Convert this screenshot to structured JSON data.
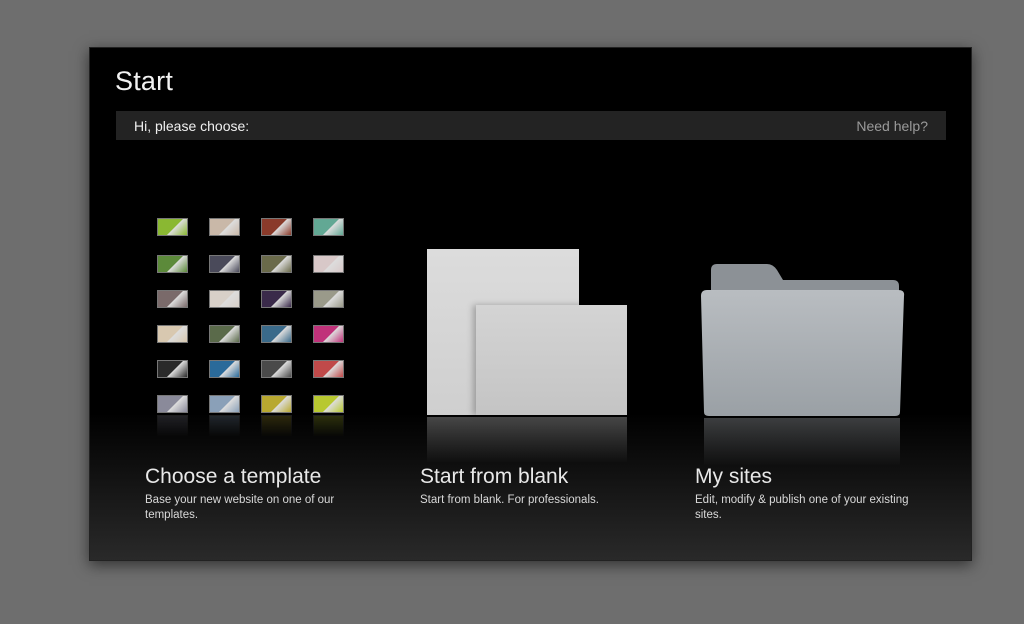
{
  "dialog": {
    "title": "Start",
    "greeting": "Hi, please choose:",
    "help_link": "Need help?"
  },
  "options": {
    "template": {
      "label": "Choose a template",
      "description": "Base your new website on one of our templates."
    },
    "blank": {
      "label": "Start from blank",
      "description": "Start from blank. For professionals."
    },
    "sites": {
      "label": "My sites",
      "description": "Edit, modify & publish one of your existing sites."
    }
  },
  "colors": {
    "backdrop": "#6e6e6e",
    "dialog_bg": "#000000",
    "bar_bg": "#232323",
    "help_text": "#9a9a9a",
    "folder": "#a9aeb2"
  },
  "template_thumb_colors": [
    "#8ab832",
    "#c9b8a8",
    "#8a3a2a",
    "#62a894",
    "#5c8a3a",
    "#4a4a5a",
    "#6a6a4a",
    "#d8c8c8",
    "#7a6a6a",
    "#d8d0c8",
    "#3a2a4a",
    "#9a9a8a",
    "#d8c8b0",
    "#5a6a4a",
    "#3a6a8a",
    "#c0327a",
    "#2a2a2a",
    "#2a6a9a",
    "#4a4a4a",
    "#c04a4a",
    "#8a8a9a",
    "#8aa0b8",
    "#b8a830",
    "#b8c830"
  ]
}
